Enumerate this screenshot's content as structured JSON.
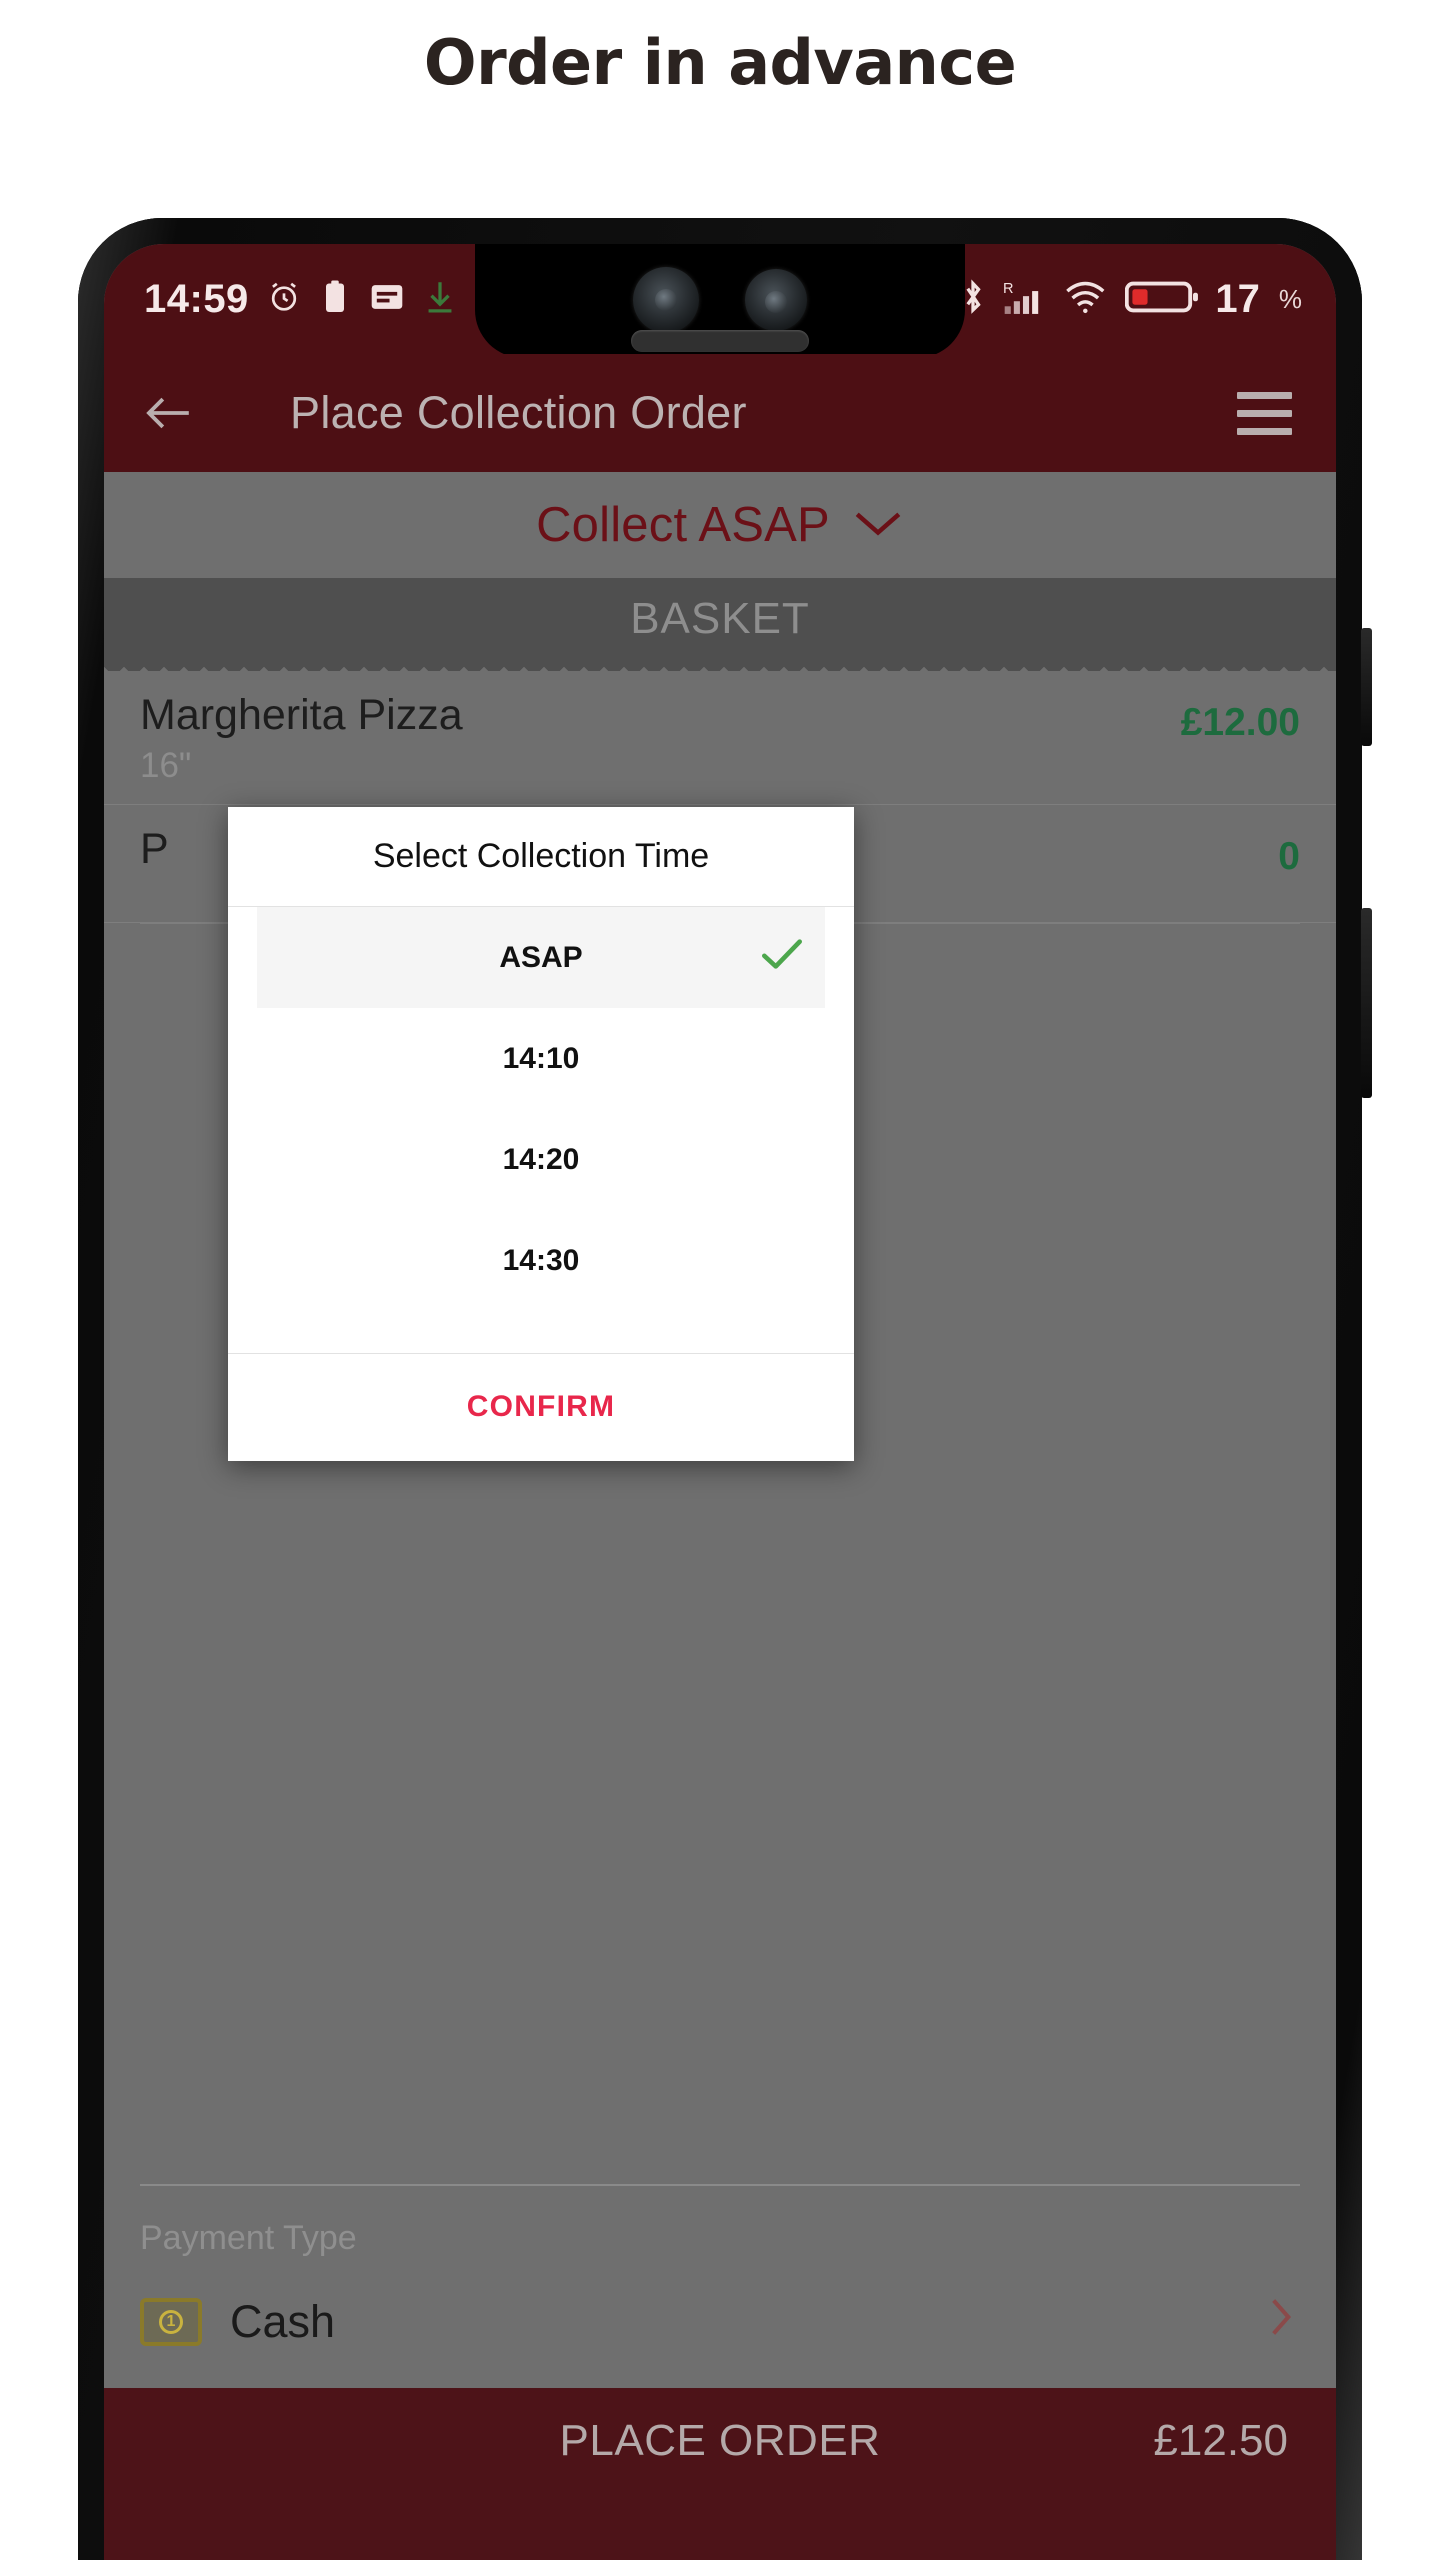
{
  "page": {
    "title": "Order in advance"
  },
  "status_bar": {
    "time": "14:59",
    "left_icons": [
      "alarm-icon",
      "clipboard-icon",
      "note-icon",
      "download-icon"
    ],
    "right_icons": [
      "location-icon",
      "bluetooth-icon",
      "roaming-signal-icon",
      "wifi-icon",
      "battery-icon"
    ],
    "signal_roaming_label": "R",
    "battery_percent": "17",
    "battery_percent_symbol": "%",
    "background_color": "#4d0f14"
  },
  "app_bar": {
    "back_icon": "arrow-left-icon",
    "title": "Place Collection Order",
    "menu_icon": "hamburger-menu-icon",
    "background_color": "#4d0f14",
    "title_color": "#bcb2b2"
  },
  "collect_bar": {
    "label": "Collect ASAP",
    "chevron_icon": "chevron-down-icon",
    "text_color": "#6b1017"
  },
  "basket": {
    "header": "BASKET",
    "items": [
      {
        "name": "Margherita Pizza",
        "option": "16\"",
        "price": "£12.00"
      },
      {
        "name": "P",
        "option": "",
        "price": "0"
      }
    ],
    "price_color": "#1d6b3e"
  },
  "payment": {
    "label": "Payment Type",
    "icon": "cash-note-icon",
    "value": "Cash",
    "chevron_icon": "chevron-right-icon"
  },
  "place_order": {
    "label": "PLACE ORDER",
    "total": "£12.50",
    "background_color": "#4d1318"
  },
  "dialog": {
    "title": "Select Collection Time",
    "options": [
      {
        "label": "ASAP",
        "selected": true
      },
      {
        "label": "14:10",
        "selected": false
      },
      {
        "label": "14:20",
        "selected": false
      },
      {
        "label": "14:30",
        "selected": false
      }
    ],
    "check_icon": "check-icon",
    "check_color": "#4ca64c",
    "confirm_label": "CONFIRM",
    "confirm_color": "#e8274b"
  }
}
